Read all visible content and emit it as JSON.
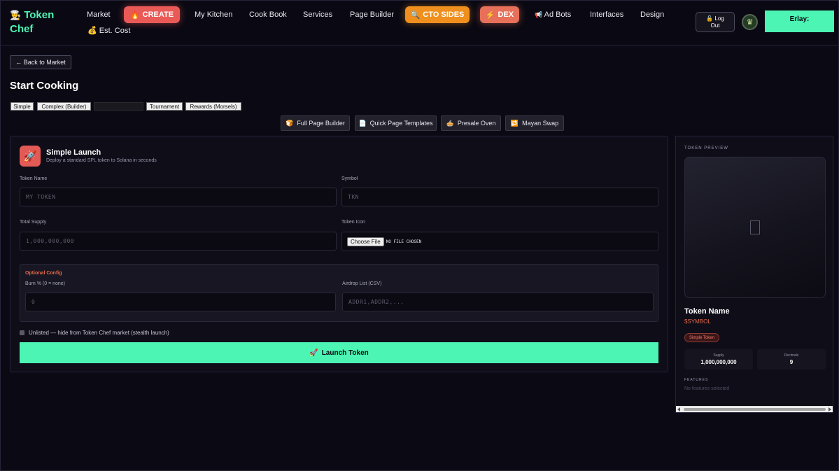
{
  "app": {
    "logo_icon": "👨‍🍳",
    "name_line1": "Token",
    "name_line2": "Chef",
    "brand_color": "#4cf5b3"
  },
  "nav": {
    "market": "Market",
    "create": "CREATE",
    "create_icon": "🔥",
    "my_kitchen": "My Kitchen",
    "cook_book": "Cook Book",
    "services": "Services",
    "page_builder": "Page Builder",
    "cto_sides": "CTO SIDES",
    "cto_icon": "🔍",
    "dex": "DEX",
    "dex_icon": "⚡",
    "ad_bots": "Ad Bots",
    "ad_bots_icon": "📢",
    "interfaces": "Interfaces",
    "design": "Design",
    "est_cost": "Est. Cost",
    "est_cost_icon": "💰",
    "logout_icon": "🔓",
    "logout_label_1": "Log",
    "logout_label_2": "Out",
    "wallet": "Erlay:"
  },
  "page": {
    "back_label": "← Back to Market",
    "title": "Start Cooking"
  },
  "mode_tabs": {
    "simple": "Simple",
    "complex": "Complex (Builder)",
    "hidden": "",
    "tournament": "Tournament",
    "rewards": "Rewards (Morsels)"
  },
  "tools": {
    "full_page_builder": "Full Page Builder",
    "full_page_builder_icon": "🍞",
    "quick_templates": "Quick Page Templates",
    "quick_templates_icon": "📄",
    "presale_oven": "Presale Oven",
    "presale_oven_icon": "🥧",
    "mayan_swap": "Mayan Swap",
    "mayan_swap_icon": "🔁"
  },
  "form": {
    "icon": "🚀",
    "title": "Simple Launch",
    "subtitle": "Deploy a standard SPL token to Solana in seconds",
    "token_name_label": "Token Name",
    "token_name_placeholder": "MY TOKEN",
    "symbol_label": "Symbol",
    "symbol_placeholder": "TKN",
    "supply_label": "Total Supply",
    "supply_placeholder": "1,000,000,000",
    "icon_label": "Token Icon",
    "choose_file": "Choose File",
    "no_file": "NO FILE CHOSEN",
    "optional_title": "Optional Config",
    "burn_label": "Burn % (0 = none)",
    "burn_placeholder": "0",
    "airdrop_label": "Airdrop List (CSV)",
    "airdrop_placeholder": "ADDR1,ADDR2,...",
    "unlisted_label": "Unlisted — hide from Token Chef market (stealth launch)",
    "launch_icon": "🚀",
    "launch_label": "Launch Token"
  },
  "preview": {
    "title": "TOKEN PREVIEW",
    "name": "Token Name",
    "symbol": "$SYMBOL",
    "badge": "Simple Token",
    "supply_label": "Supply",
    "supply_value": "1,000,000,000",
    "decimals_label": "Decimals",
    "decimals_value": "9",
    "features_title": "FEATURES",
    "features_empty": "No features selected"
  }
}
